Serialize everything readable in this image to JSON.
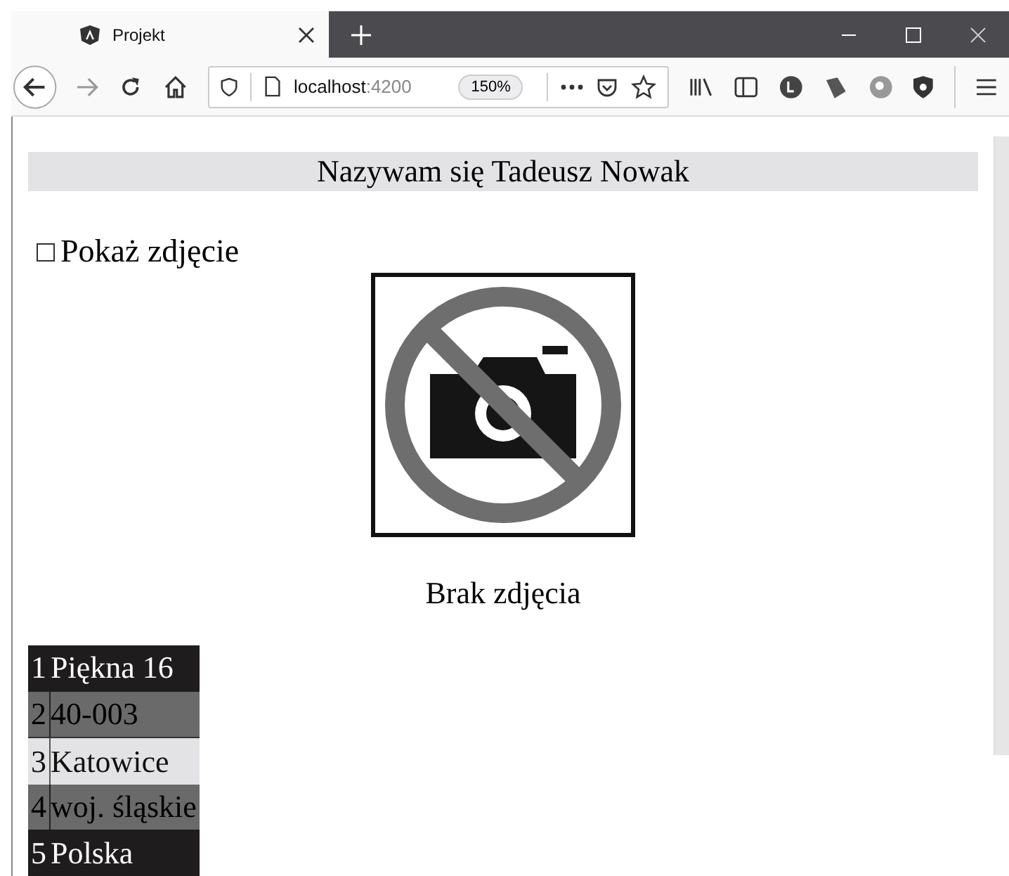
{
  "tab": {
    "title": "Projekt",
    "selected": true
  },
  "address": {
    "host": "localhost",
    "port": ":4200",
    "zoom": "150%"
  },
  "heading": "Nazywam się Tadeusz Nowak",
  "show_photo": {
    "label": "Pokaż zdjęcie",
    "checked": false
  },
  "photo": {
    "kind": "placeholder",
    "caption": "Brak zdjęcia"
  },
  "address_rows": [
    {
      "number": "1",
      "text": "Piękna 16",
      "kind": "dark"
    },
    {
      "number": "2",
      "text": "40-003",
      "kind": "dim"
    },
    {
      "number": "3",
      "text": "Katowice",
      "kind": "light"
    },
    {
      "number": "4",
      "text": "woj. śląskie",
      "kind": "dim"
    },
    {
      "number": "5",
      "text": "Polska",
      "kind": "dark"
    }
  ]
}
